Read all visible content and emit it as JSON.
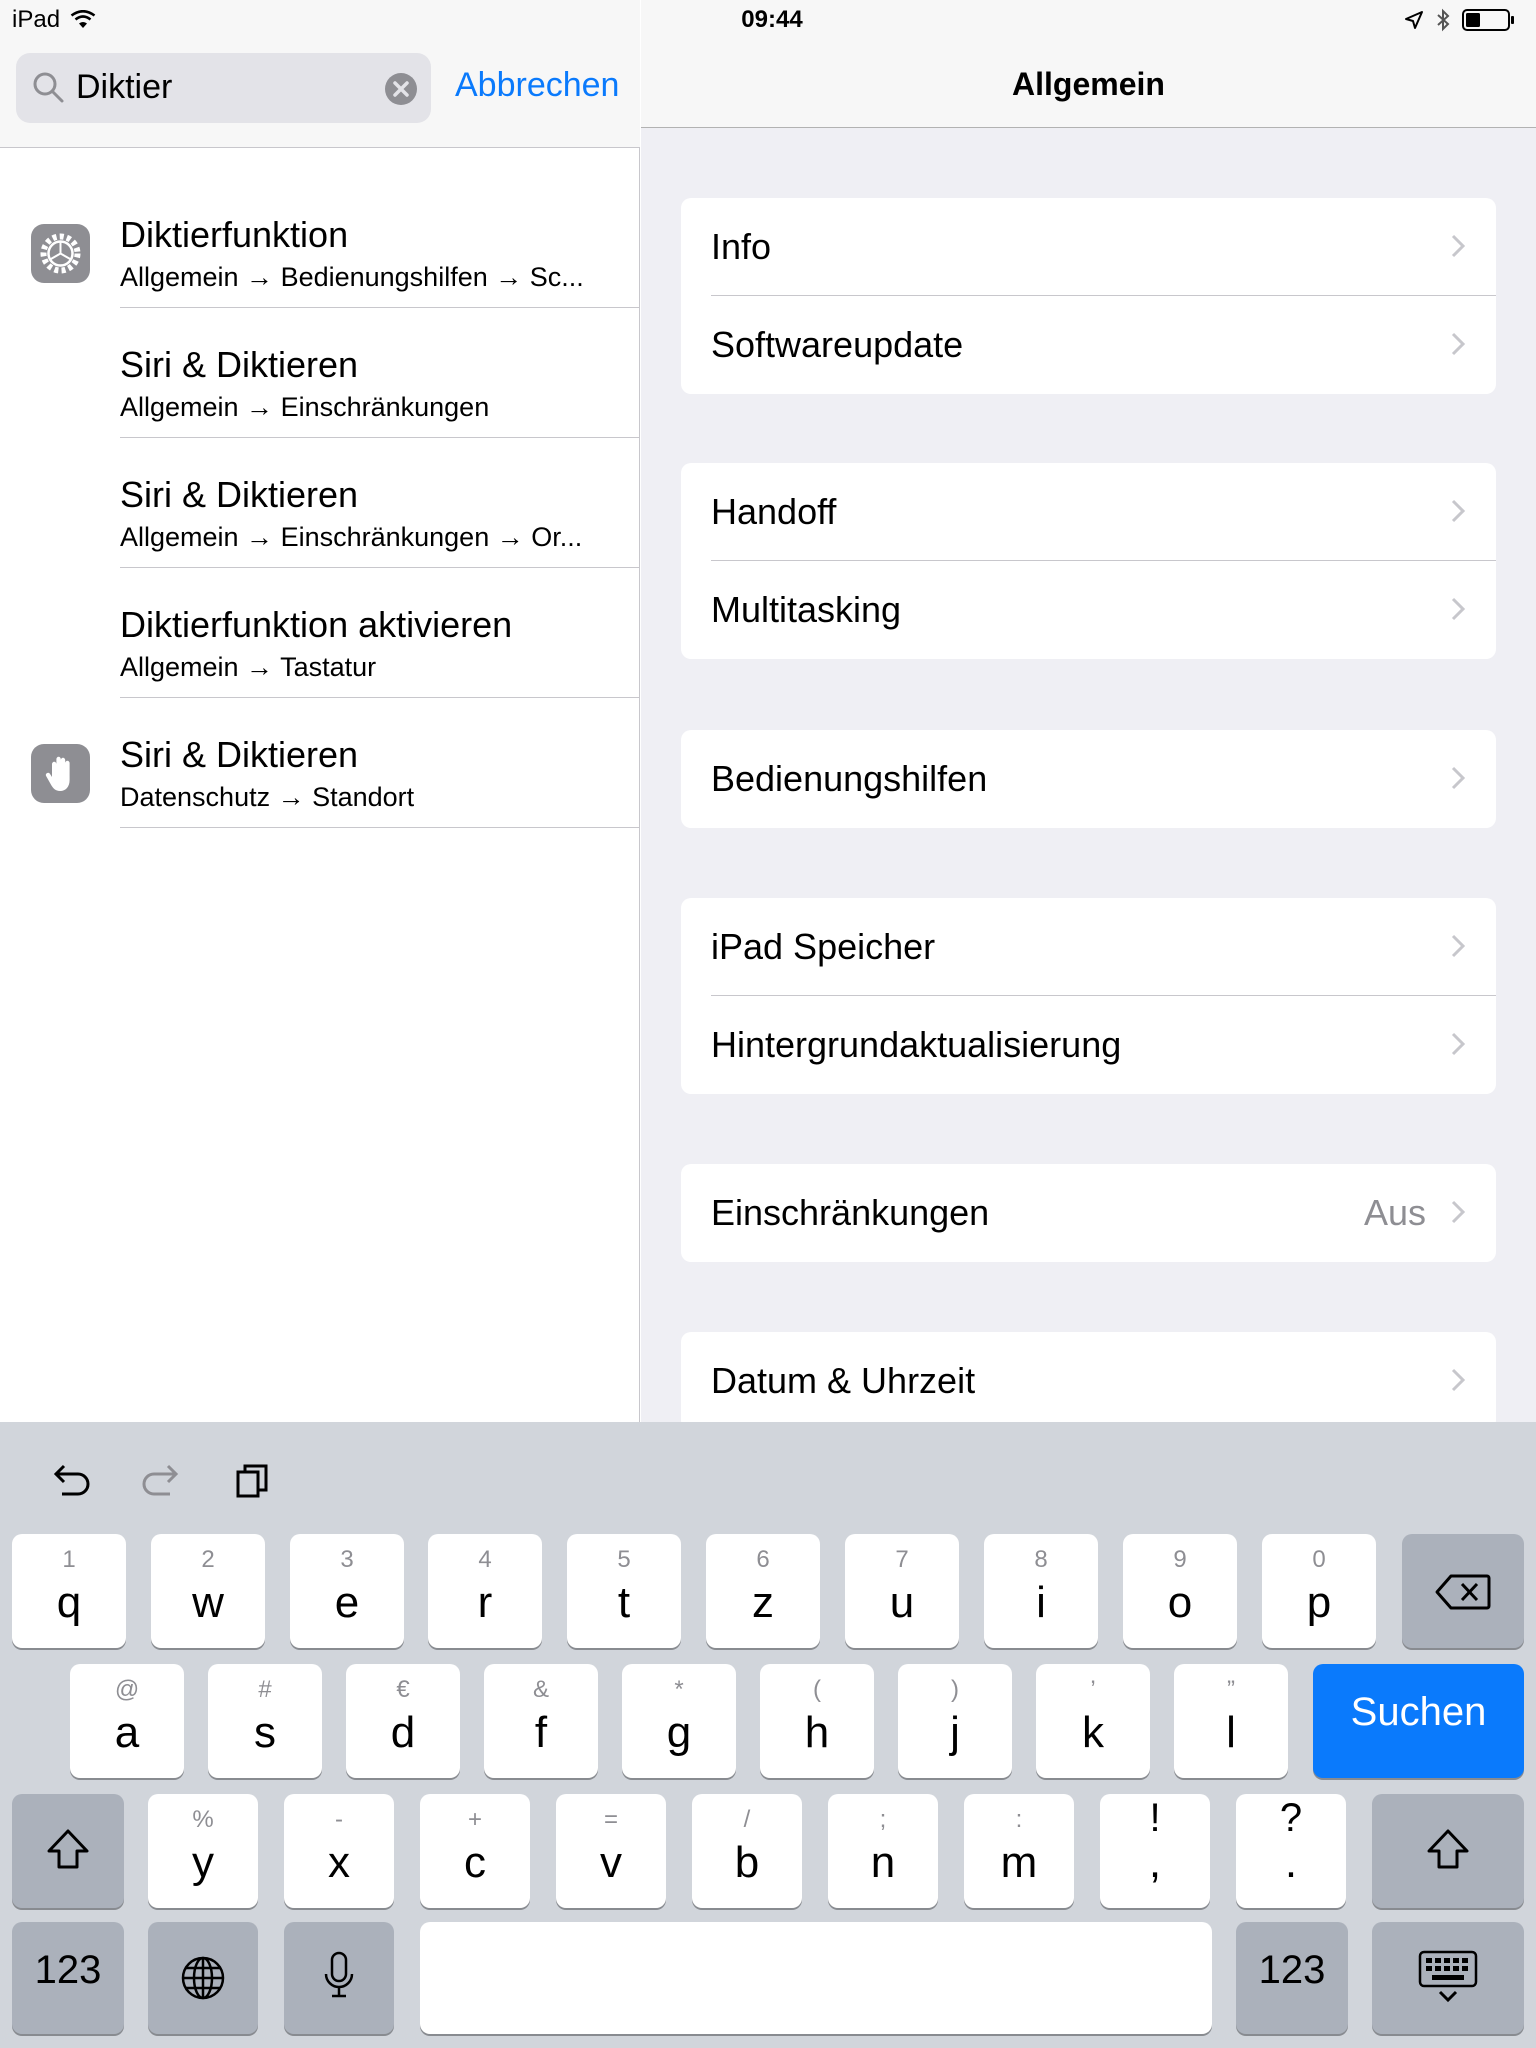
{
  "status_bar": {
    "device": "iPad",
    "time": "09:44"
  },
  "search": {
    "query": "Diktier",
    "cancel_label": "Abbrechen"
  },
  "results": [
    {
      "title": "Diktierfunktion",
      "path": "Allgemein → Bedienungshilfen → Sc...",
      "icon": "gear-icon"
    },
    {
      "title": "Siri & Diktieren",
      "path": "Allgemein → Einschränkungen",
      "icon": ""
    },
    {
      "title": "Siri & Diktieren",
      "path": "Allgemein → Einschränkungen → Or...",
      "icon": ""
    },
    {
      "title": "Diktierfunktion aktivieren",
      "path": "Allgemein → Tastatur",
      "icon": ""
    },
    {
      "title": "Siri & Diktieren",
      "path": "Datenschutz → Standort",
      "icon": "hand-icon"
    }
  ],
  "detail": {
    "title": "Allgemein",
    "groups": [
      [
        {
          "label": "Info"
        },
        {
          "label": "Softwareupdate"
        }
      ],
      [
        {
          "label": "Handoff"
        },
        {
          "label": "Multitasking"
        }
      ],
      [
        {
          "label": "Bedienungshilfen"
        }
      ],
      [
        {
          "label": "iPad Speicher"
        },
        {
          "label": "Hintergrundaktualisierung"
        }
      ],
      [
        {
          "label": "Einschränkungen",
          "value": "Aus"
        }
      ],
      [
        {
          "label": "Datum & Uhrzeit"
        }
      ]
    ]
  },
  "keyboard": {
    "row1": [
      {
        "main": "q",
        "hint": "1"
      },
      {
        "main": "w",
        "hint": "2"
      },
      {
        "main": "e",
        "hint": "3"
      },
      {
        "main": "r",
        "hint": "4"
      },
      {
        "main": "t",
        "hint": "5"
      },
      {
        "main": "z",
        "hint": "6"
      },
      {
        "main": "u",
        "hint": "7"
      },
      {
        "main": "i",
        "hint": "8"
      },
      {
        "main": "o",
        "hint": "9"
      },
      {
        "main": "p",
        "hint": "0"
      }
    ],
    "row2": [
      {
        "main": "a",
        "hint": "@"
      },
      {
        "main": "s",
        "hint": "#"
      },
      {
        "main": "d",
        "hint": "€"
      },
      {
        "main": "f",
        "hint": "&"
      },
      {
        "main": "g",
        "hint": "*"
      },
      {
        "main": "h",
        "hint": "("
      },
      {
        "main": "j",
        "hint": ")"
      },
      {
        "main": "k",
        "hint": "’"
      },
      {
        "main": "l",
        "hint": "”"
      }
    ],
    "row3": [
      {
        "main": "y",
        "hint": "%"
      },
      {
        "main": "x",
        "hint": "-"
      },
      {
        "main": "c",
        "hint": "+"
      },
      {
        "main": "v",
        "hint": "="
      },
      {
        "main": "b",
        "hint": "/"
      },
      {
        "main": "n",
        "hint": ";"
      },
      {
        "main": "m",
        "hint": ":"
      },
      {
        "main": ",",
        "hint": "!"
      },
      {
        "main": ".",
        "hint": "?"
      }
    ],
    "search_label": "Suchen",
    "numbers_label": "123",
    "accent_color": "#0a7afc"
  }
}
